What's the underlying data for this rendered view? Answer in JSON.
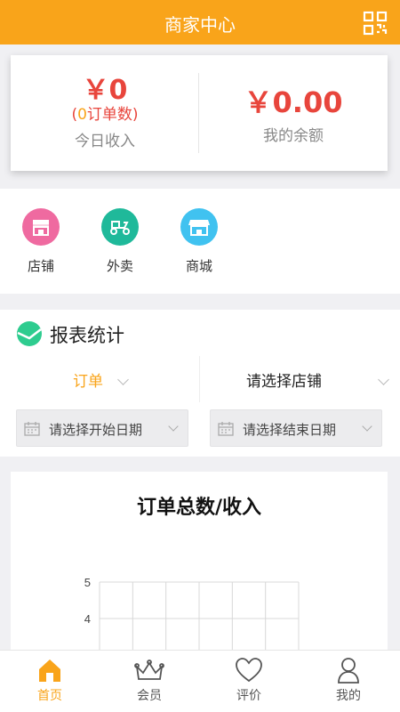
{
  "header": {
    "title": "商家中心",
    "qr_icon": "qr-code-icon"
  },
  "income": {
    "today_amount": "￥0",
    "order_count_prefix": "(",
    "order_count_value": "0",
    "order_count_suffix": "订单数)",
    "today_caption": "今日收入",
    "balance_amount": "￥0.00",
    "balance_caption": "我的余额"
  },
  "shortcuts": [
    {
      "label": "店铺",
      "icon": "shop-icon",
      "color": "#ef6aa0"
    },
    {
      "label": "外卖",
      "icon": "scooter-icon",
      "color": "#1fb99a"
    },
    {
      "label": "商城",
      "icon": "store-icon",
      "color": "#40c2f0"
    }
  ],
  "report": {
    "title": "报表统计",
    "type_select": "订单",
    "shop_select": "请选择店铺",
    "start_date_placeholder": "请选择开始日期",
    "end_date_placeholder": "请选择结束日期"
  },
  "chart_data": {
    "type": "bar",
    "title": "订单总数/收入",
    "xlabel": "",
    "ylabel": "",
    "ylim": [
      0,
      5
    ],
    "y_ticks": [
      "5",
      "4"
    ],
    "categories": [],
    "series": [],
    "grid": true
  },
  "tabbar": [
    {
      "label": "首页",
      "icon": "home-icon",
      "active": true
    },
    {
      "label": "会员",
      "icon": "crown-icon",
      "active": false
    },
    {
      "label": "评价",
      "icon": "heart-icon",
      "active": false
    },
    {
      "label": "我的",
      "icon": "user-icon",
      "active": false
    }
  ],
  "colors": {
    "brand": "#f9a41a",
    "amount": "#e8453c",
    "report_icon": "#2ecc8f"
  }
}
